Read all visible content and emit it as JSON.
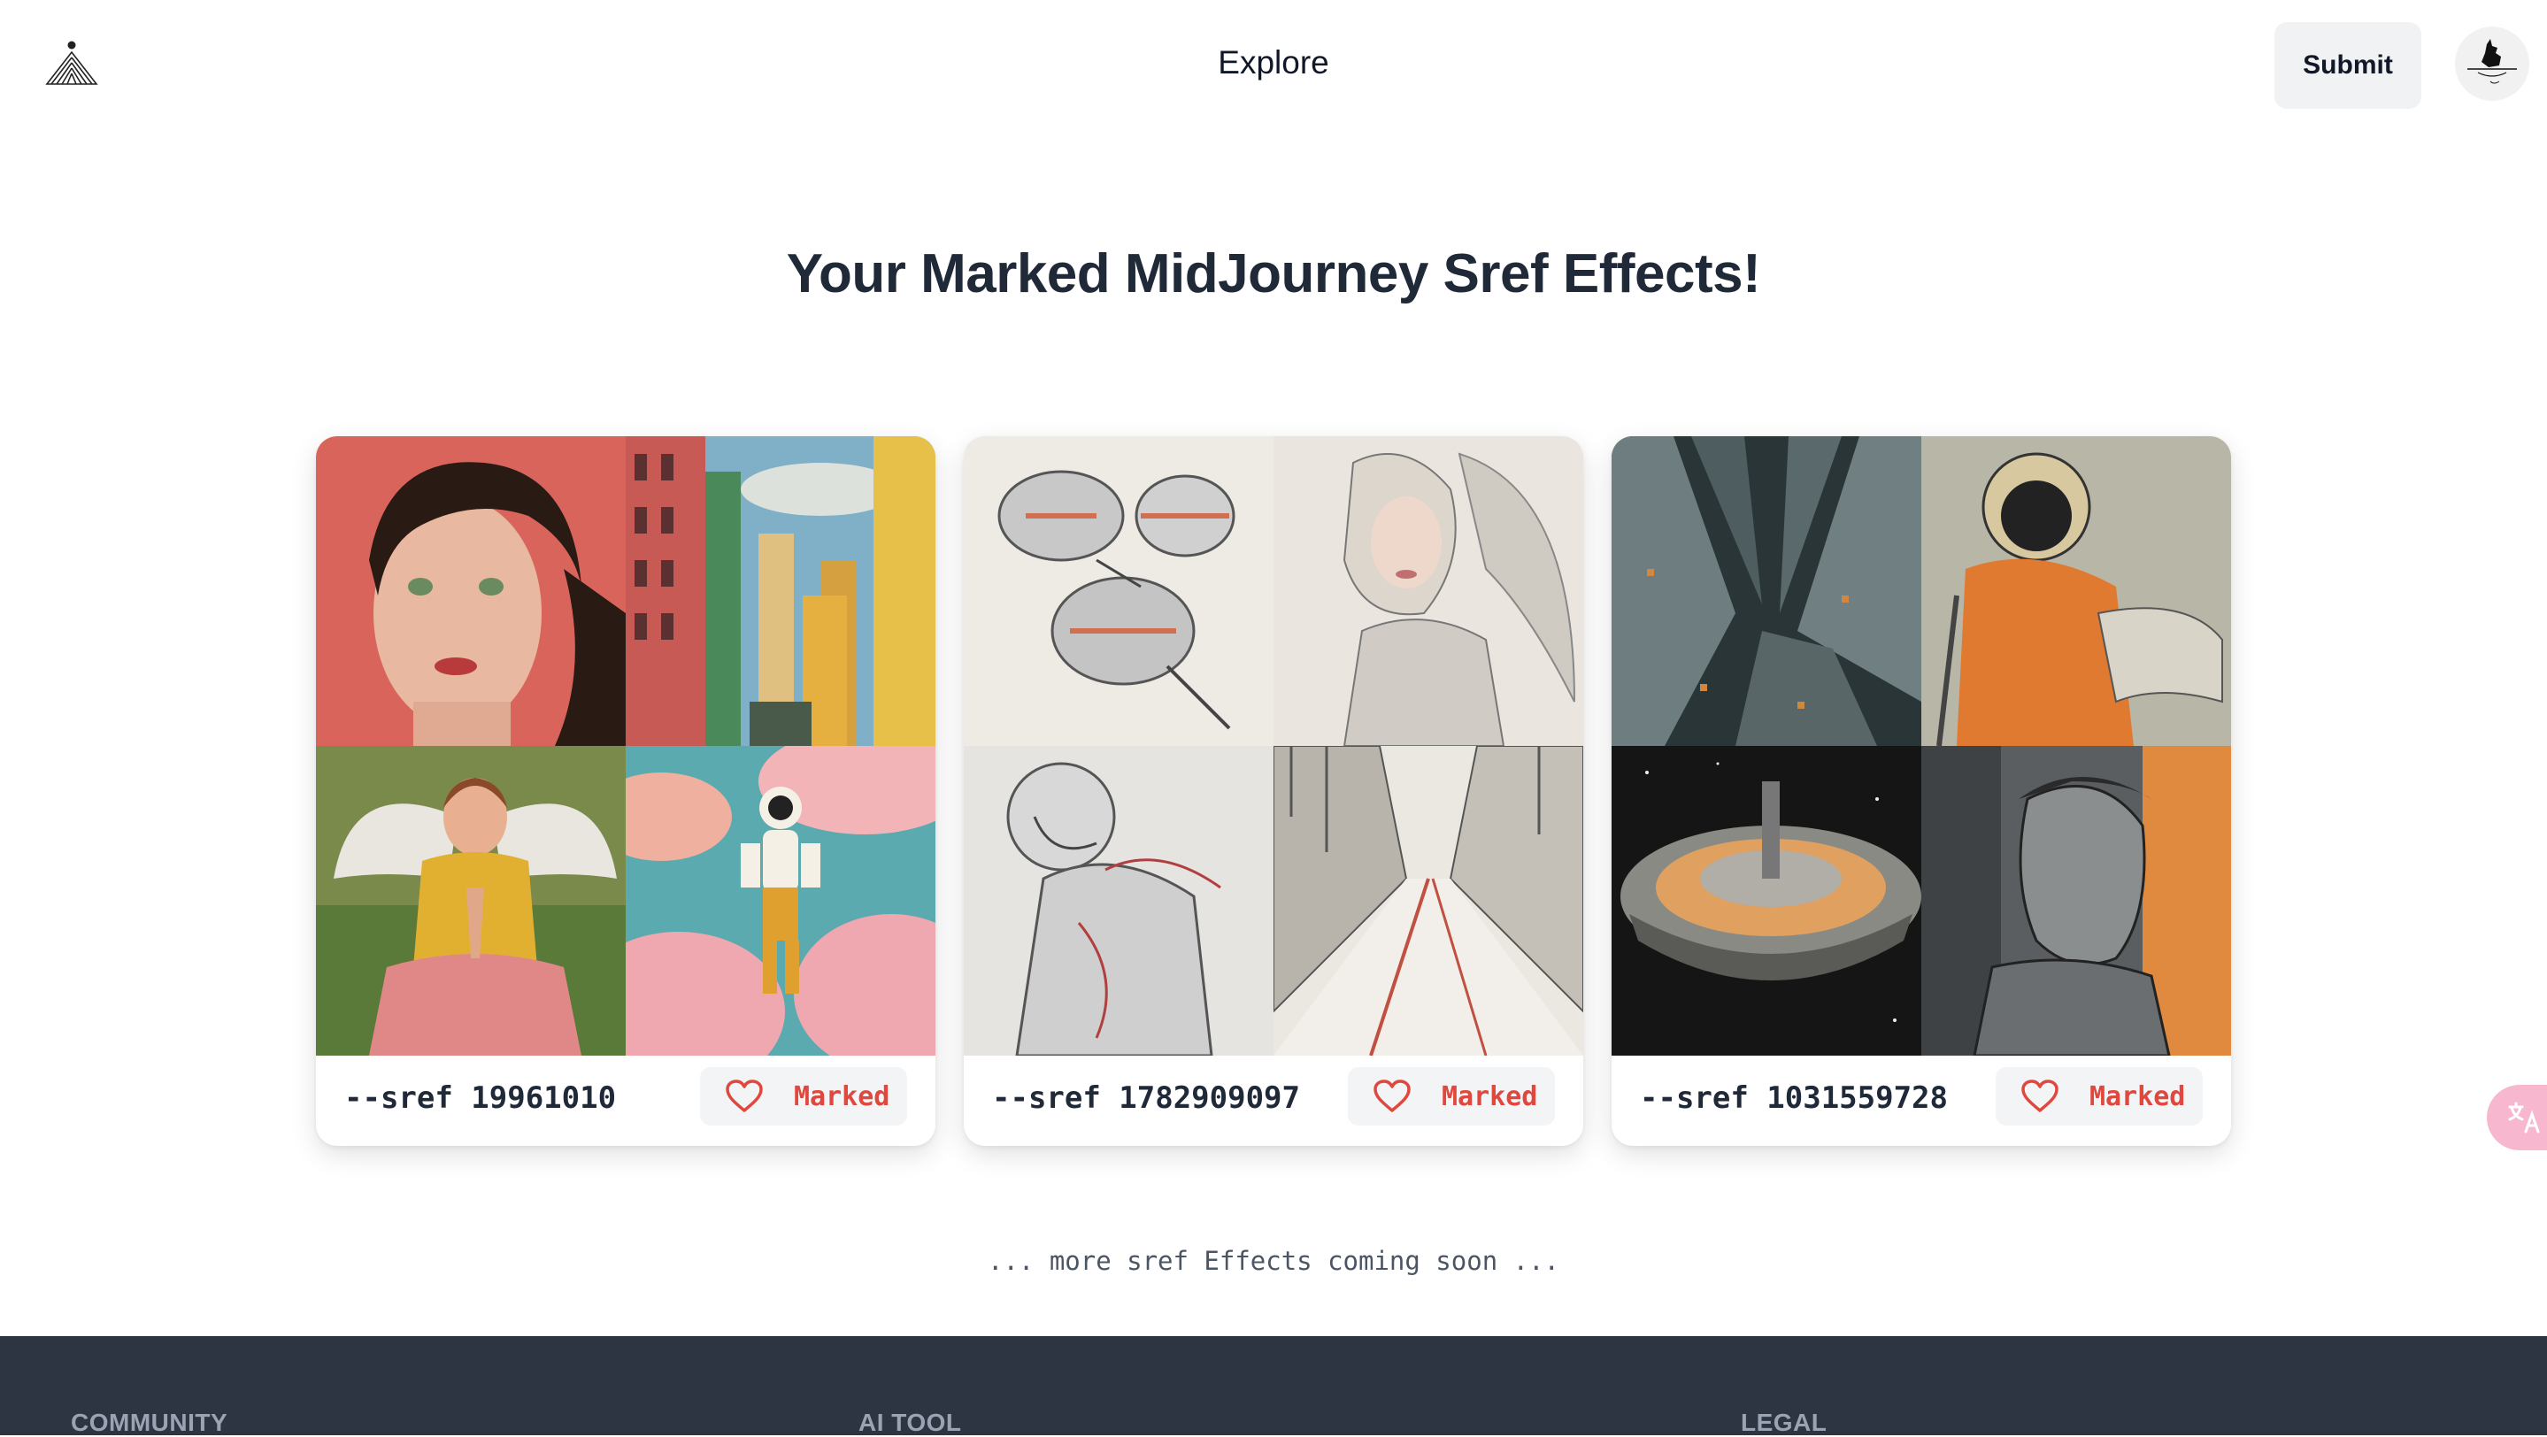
{
  "header": {
    "logo_icon": "pyramid-logo-icon",
    "nav_explore": "Explore",
    "submit_label": "Submit",
    "avatar_icon": "user-avatar-icon"
  },
  "main": {
    "title": "Your Marked MidJourney Sref Effects!",
    "cards": [
      {
        "sref": "--sref 19961010",
        "mark_label": "Marked",
        "mark_icon": "heart-icon",
        "images": [
          "portrait-woman-image",
          "city-buildings-image",
          "angel-girl-image",
          "astronaut-clouds-image"
        ]
      },
      {
        "sref": "--sref 1782909097",
        "mark_label": "Marked",
        "mark_icon": "heart-icon",
        "images": [
          "spaceship-sketch-image",
          "angel-sketch-image",
          "astronaut-sketch-image",
          "city-street-sketch-image"
        ]
      },
      {
        "sref": "--sref 1031559728",
        "mark_label": "Marked",
        "mark_icon": "heart-icon",
        "images": [
          "skyscrapers-aerial-image",
          "astronaut-orange-image",
          "space-station-image",
          "man-portrait-orange-image"
        ]
      }
    ],
    "coming_soon": "... more sref Effects coming soon ..."
  },
  "translate_icon": "translate-icon",
  "footer": {
    "col1": "COMMUNITY",
    "col2": "AI TOOL",
    "col3": "LEGAL"
  },
  "colors": {
    "accent_red": "#e0483e",
    "footer_bg": "#2d3442",
    "translate_bg": "#f7b8cf"
  }
}
